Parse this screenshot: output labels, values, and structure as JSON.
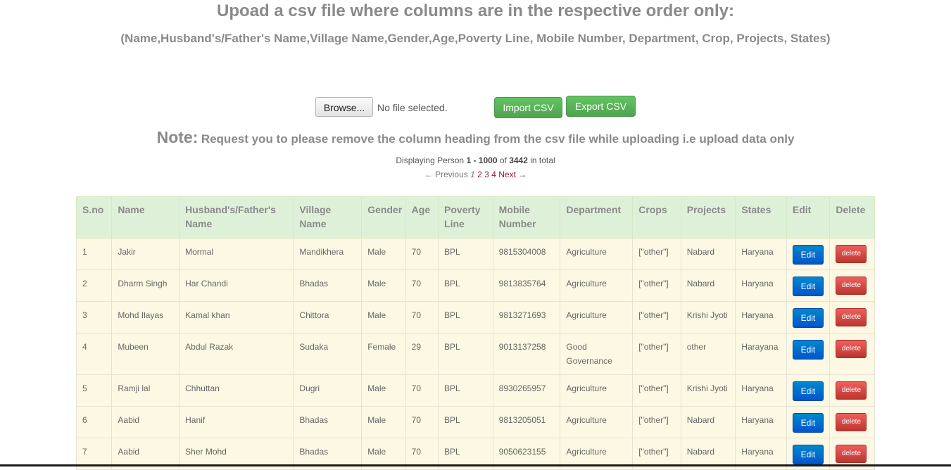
{
  "header": {
    "title": "Upoad a csv file where columns are in the respective order only:",
    "subtitle": "(Name,Husband's/Father's Name,Village Name,Gender,Age,Poverty Line, Mobile Number, Department, Crop, Projects, States)"
  },
  "upload": {
    "browse_label": "Browse...",
    "file_status": "No file selected.",
    "import_label": "Import CSV",
    "export_label": "Export CSV"
  },
  "note": {
    "heading": "Note:",
    "text": "Request you to please remove the column heading from the csv file while uploading i.e upload data only"
  },
  "pager": {
    "prefix": "Displaying Person",
    "range": "1 - 1000",
    "of": "of",
    "total": "3442",
    "suffix": "in total",
    "previous": "← Previous",
    "current": "1",
    "pages": [
      "2",
      "3",
      "4"
    ],
    "next": "Next →"
  },
  "table": {
    "columns": [
      "S.no",
      "Name",
      "Husband's/Father's Name",
      "Village Name",
      "Gender",
      "Age",
      "Poverty Line",
      "Mobile Number",
      "Department",
      "Crops",
      "Projects",
      "States",
      "Edit",
      "Delete"
    ],
    "edit_label": "Edit",
    "delete_label": "delete",
    "rows": [
      [
        "1",
        "Jakir",
        "Mormal",
        "Mandikhera",
        "Male",
        "70",
        "BPL",
        "9815304008",
        "Agriculture",
        "[\"other\"]",
        "Nabard",
        "Haryana"
      ],
      [
        "2",
        "Dharm Singh",
        "Har Chandi",
        "Bhadas",
        "Male",
        "70",
        "BPL",
        "9813835764",
        "Agriculture",
        "[\"other\"]",
        "Nabard",
        "Haryana"
      ],
      [
        "3",
        "Mohd Ilayas",
        "Kamal khan",
        "Chittora",
        "Male",
        "70",
        "BPL",
        "9813271693",
        "Agriculture",
        "[\"other\"]",
        "Krishi Jyoti",
        "Haryana"
      ],
      [
        "4",
        "Mubeen",
        "Abdul Razak",
        "Sudaka",
        "Female",
        "29",
        "BPL",
        "9013137258",
        "Good Governance",
        "[\"other\"]",
        "other",
        "Harayana"
      ],
      [
        "5",
        "Ramji lal",
        "Chhuttan",
        "Dugri",
        "Male",
        "70",
        "BPL",
        "8930265957",
        "Agriculture",
        "[\"other\"]",
        "Krishi Jyoti",
        "Haryana"
      ],
      [
        "6",
        "Aabid",
        "Hanif",
        "Bhadas",
        "Male",
        "70",
        "BPL",
        "9813205051",
        "Agriculture",
        "[\"other\"]",
        "Nabard",
        "Haryana"
      ],
      [
        "7",
        "Aabid",
        "Sher Mohd",
        "Bhadas",
        "Male",
        "70",
        "BPL",
        "9050623155",
        "Agriculture",
        "[\"other\"]",
        "Nabard",
        "Haryana"
      ]
    ]
  }
}
